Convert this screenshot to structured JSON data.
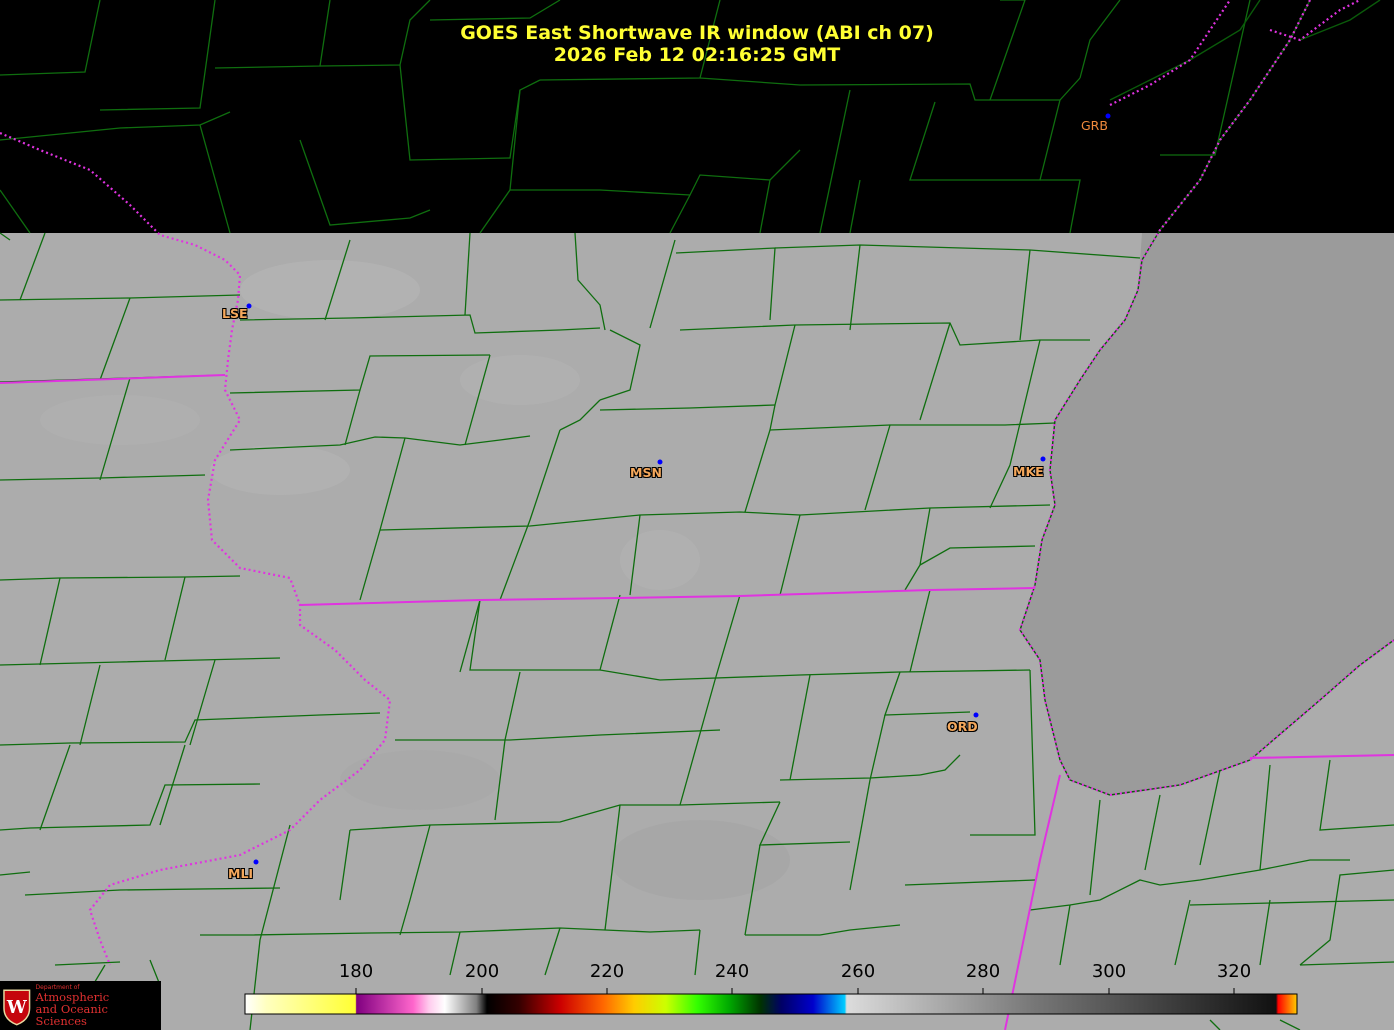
{
  "title": {
    "line1": "GOES East Shortwave IR window (ABI ch 07)",
    "line2": "2026 Feb 12  02:16:25 GMT"
  },
  "stations": [
    {
      "code": "GRB"
    },
    {
      "code": "LSE"
    },
    {
      "code": "MSN"
    },
    {
      "code": "MKE"
    },
    {
      "code": "ORD"
    },
    {
      "code": "MLI"
    }
  ],
  "colorbar": {
    "ticks": [
      "180",
      "200",
      "220",
      "240",
      "260",
      "280",
      "300",
      "320"
    ]
  },
  "logo": {
    "small_text": "Department of",
    "line1": "Atmospheric",
    "line2": "and Oceanic Sciences"
  },
  "colors": {
    "title": "#ffff33",
    "county_lines": "#0f6e0f",
    "state_lines": "#e033e0",
    "station_dots": "#0000ff",
    "label": "#f5a85c",
    "cloud_gray": "#ababab",
    "lake_gray": "#9c9c9c"
  }
}
